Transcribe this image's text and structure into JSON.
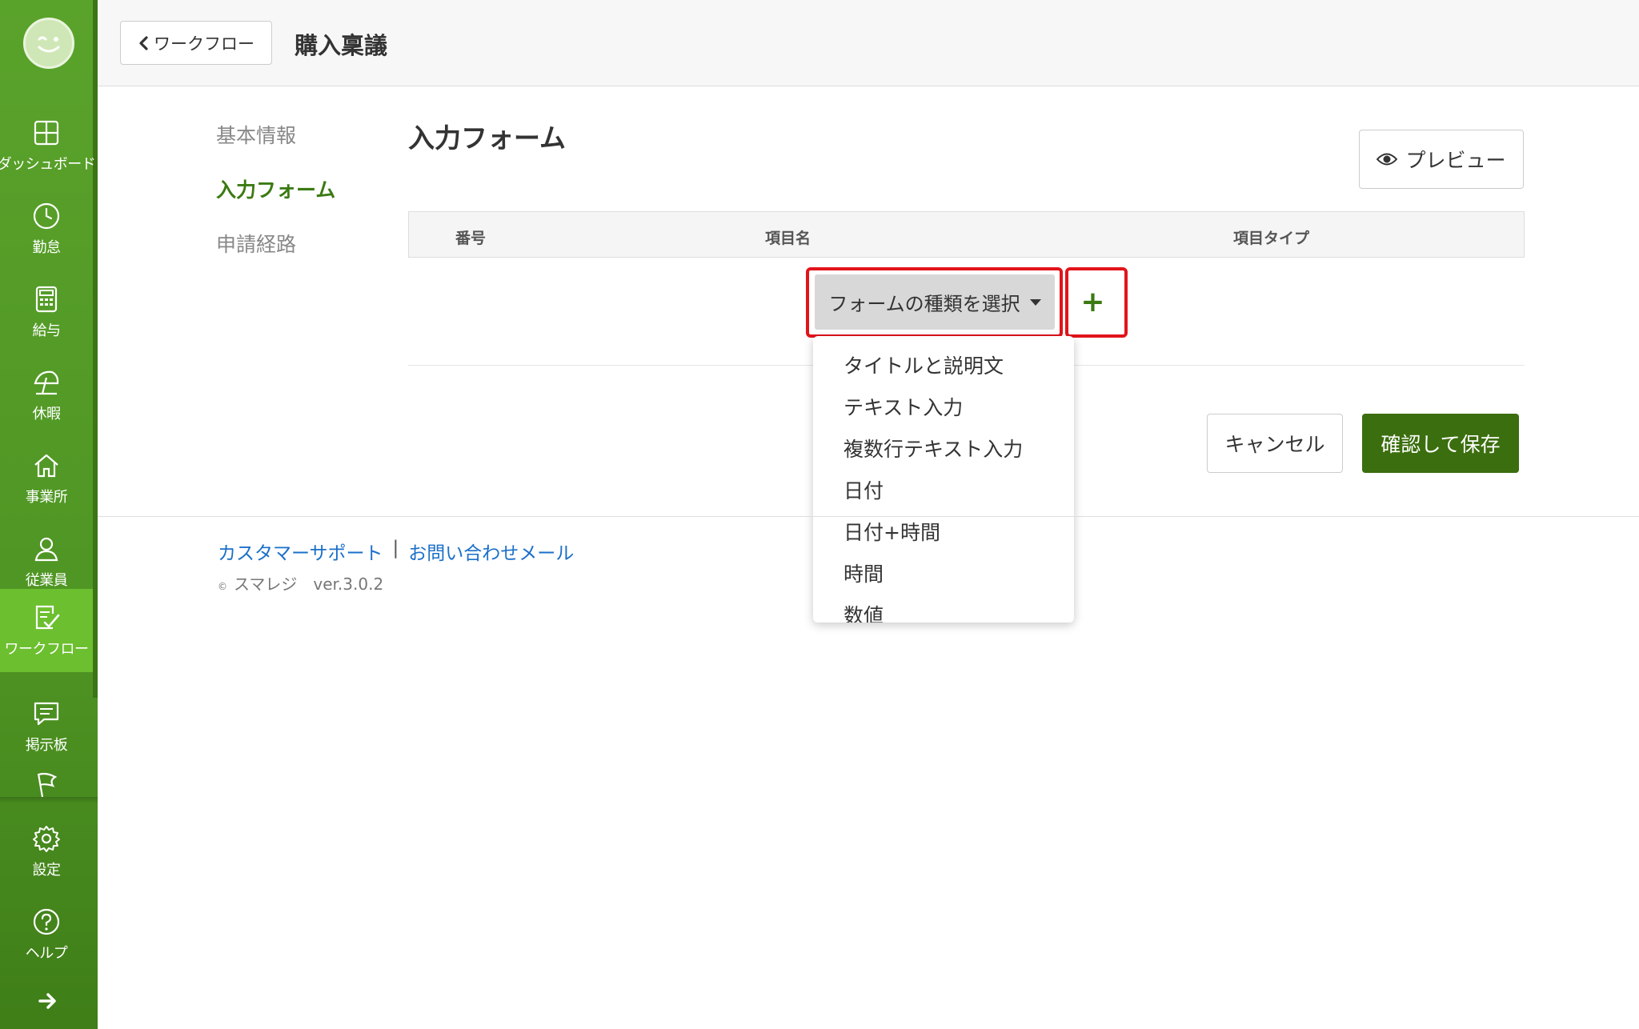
{
  "header": {
    "back_label": "ワークフロー",
    "title": "購入稟議"
  },
  "sidebar": {
    "items": [
      {
        "label": "ダッシュボード",
        "icon": "dashboard-icon"
      },
      {
        "label": "勤怠",
        "icon": "clock-icon"
      },
      {
        "label": "給与",
        "icon": "calculator-icon"
      },
      {
        "label": "休暇",
        "icon": "beach-umbrella-icon"
      },
      {
        "label": "事業所",
        "icon": "home-icon"
      },
      {
        "label": "従業員",
        "icon": "person-icon"
      },
      {
        "label": "ワークフロー",
        "icon": "checklist-icon"
      },
      {
        "label": "掲示板",
        "icon": "chat-icon"
      },
      {
        "label": "",
        "icon": "flag-icon"
      },
      {
        "label": "設定",
        "icon": "gear-icon"
      },
      {
        "label": "ヘルプ",
        "icon": "help-icon"
      }
    ],
    "active": "ワークフロー",
    "accent": "#5aa32b"
  },
  "nav": {
    "items": [
      "基本情報",
      "入力フォーム",
      "申請経路"
    ],
    "active": "入力フォーム"
  },
  "main": {
    "section_title": "入力フォーム",
    "preview_label": "プレビュー",
    "table_headers": [
      "番号",
      "項目名",
      "項目タイプ"
    ],
    "select_label": "フォームの種類を選択",
    "add_symbol": "+",
    "dropdown_options": [
      "タイトルと説明文",
      "テキスト入力",
      "複数行テキスト入力",
      "日付",
      "日付+時間",
      "時間",
      "数値"
    ],
    "cancel_label": "キャンセル",
    "save_label": "確認して保存"
  },
  "footer": {
    "support_link": "カスタマーサポート",
    "separator": "|",
    "contact_link": "お問い合わせメール",
    "copyright_symbol": "©",
    "brand": "スマレジ",
    "version": "ver.3.0.2"
  },
  "colors": {
    "highlight": "#e2141b",
    "save_button": "#3b6e0e",
    "link": "#1a6fc9"
  }
}
